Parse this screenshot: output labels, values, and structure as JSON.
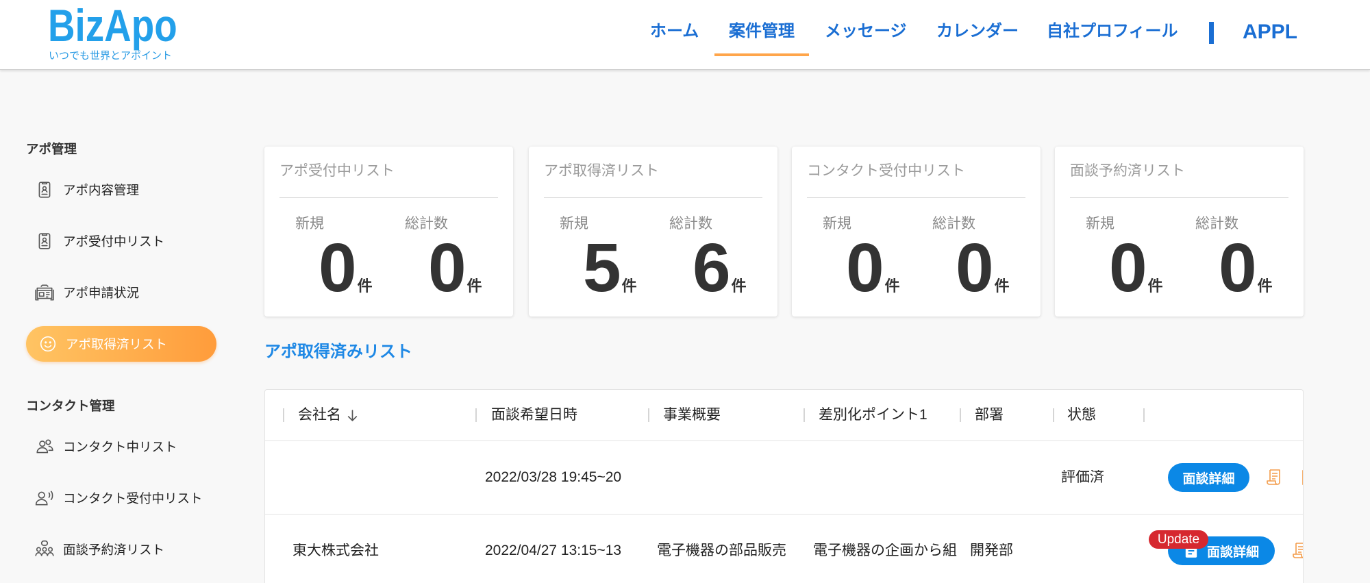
{
  "brand": {
    "name": "BizApo",
    "tagline": "いつでも世界とアポイント"
  },
  "nav": {
    "items": [
      {
        "label": "ホーム"
      },
      {
        "label": "案件管理",
        "active": true
      },
      {
        "label": "メッセージ"
      },
      {
        "label": "カレンダー"
      },
      {
        "label": "自社プロフィール"
      }
    ],
    "account": "APPL"
  },
  "sidebar": {
    "sections": [
      {
        "title": "アポ管理",
        "items": [
          {
            "label": "アポ内容管理",
            "icon": "document-user-icon"
          },
          {
            "label": "アポ受付中リスト",
            "icon": "document-user-icon"
          },
          {
            "label": "アポ申請状況",
            "icon": "application-status-icon"
          },
          {
            "label": "アポ取得済リスト",
            "icon": "smile-icon",
            "active": true
          }
        ]
      },
      {
        "title": "コンタクト管理",
        "items": [
          {
            "label": "コンタクト中リスト",
            "icon": "users-icon"
          },
          {
            "label": "コンタクト受付中リスト",
            "icon": "user-voice-icon"
          },
          {
            "label": "面談予約済リスト",
            "icon": "team-icon"
          }
        ]
      }
    ]
  },
  "summary_cards": [
    {
      "title": "アポ受付中リスト",
      "new_label": "新規",
      "new_count": "0",
      "total_label": "総計数",
      "total_count": "0",
      "unit": "件"
    },
    {
      "title": "アポ取得済リスト",
      "new_label": "新規",
      "new_count": "5",
      "total_label": "総計数",
      "total_count": "6",
      "unit": "件"
    },
    {
      "title": "コンタクト受付中リスト",
      "new_label": "新規",
      "new_count": "0",
      "total_label": "総計数",
      "total_count": "0",
      "unit": "件"
    },
    {
      "title": "面談予約済リスト",
      "new_label": "新規",
      "new_count": "0",
      "total_label": "総計数",
      "total_count": "0",
      "unit": "件"
    }
  ],
  "list": {
    "title": "アポ取得済みリスト",
    "columns": [
      "会社名",
      "面談希望日時",
      "事業概要",
      "差別化ポイント1",
      "部署",
      "状態"
    ],
    "sort_icon": "arrow-down-icon",
    "rows": [
      {
        "datetime": "2022/03/28 19:45~20",
        "status": "評価済",
        "action_label": "面談詳細"
      },
      {
        "company": "東大株式会社",
        "datetime": "2022/04/27 13:15~13",
        "business": "電子機器の部品販売",
        "differentiation": "電子機器の企画から組",
        "department": "開発部",
        "action_label": "面談詳細",
        "badge": "Update"
      }
    ]
  },
  "colors": {
    "primary": "#1a6ed3",
    "accent": "#ffa54a",
    "button": "#0b88e6",
    "badge": "#d6282f",
    "section-title": "#1e88e5",
    "pill-start": "#ffc463",
    "pill-end": "#ff9c3b",
    "memo": "#f39c4a"
  }
}
